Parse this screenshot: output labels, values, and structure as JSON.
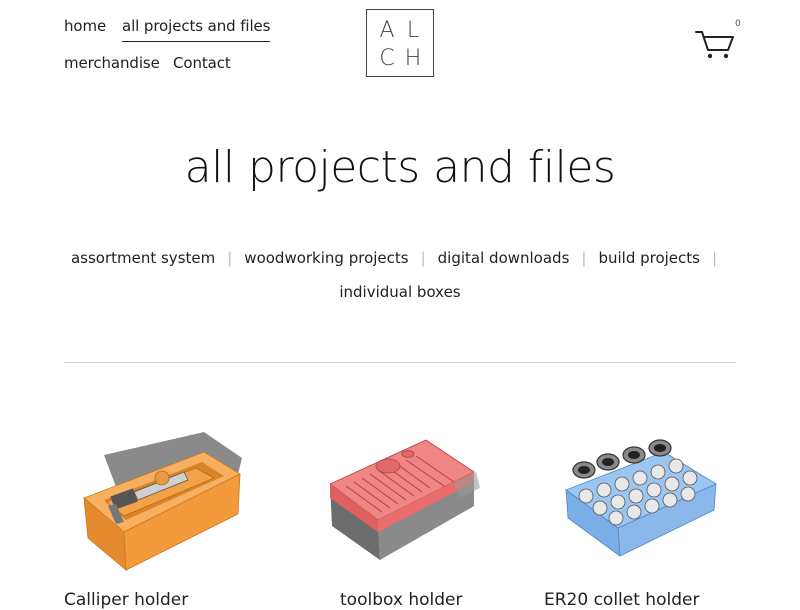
{
  "nav": {
    "home": "home",
    "all_projects": "all projects and files",
    "merchandise": "merchandise",
    "contact": "Contact"
  },
  "logo": {
    "letters": [
      "A",
      "L",
      "C",
      "H"
    ]
  },
  "cart": {
    "count": "0",
    "icon": "cart-icon"
  },
  "page_title": "all projects and files",
  "categories": [
    "assortment system",
    "woodworking projects",
    "digital downloads",
    "build projects",
    "individual boxes"
  ],
  "products": [
    {
      "title": "Calliper holder",
      "image": "orange caliper box model"
    },
    {
      "title": "toolbox holder",
      "image": "red tool organizer model"
    },
    {
      "title": "ER20 collet holder",
      "image": "blue collet holder model"
    }
  ],
  "colors": {
    "orange_model": "#f4a24a",
    "red_model": "#ee6f6f",
    "blue_model": "#8ab8ea",
    "text": "#222222",
    "divider": "#cfcfcf"
  }
}
